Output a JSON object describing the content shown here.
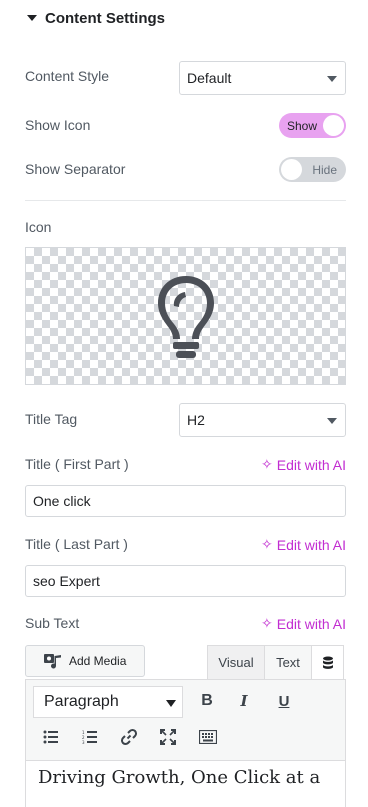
{
  "section": {
    "title": "Content Settings"
  },
  "content_style": {
    "label": "Content Style",
    "value": "Default"
  },
  "show_icon": {
    "label": "Show Icon",
    "state_text": "Show"
  },
  "show_separator": {
    "label": "Show Separator",
    "state_text": "Hide"
  },
  "icon": {
    "label": "Icon",
    "preview_icon": "lightbulb-icon"
  },
  "title_tag": {
    "label": "Title Tag",
    "value": "H2"
  },
  "title_first": {
    "label": "Title ( First Part )",
    "ai_label": "Edit with AI",
    "value": "One click"
  },
  "title_last": {
    "label": "Title ( Last Part )",
    "ai_label": "Edit with AI",
    "value": "seo Expert"
  },
  "sub_text": {
    "label": "Sub Text",
    "ai_label": "Edit with AI",
    "add_media_label": "Add Media",
    "tab_visual": "Visual",
    "tab_text": "Text",
    "format_value": "Paragraph",
    "bold": "B",
    "italic": "I",
    "underline": "U",
    "content": "Driving Growth, One Click at a"
  },
  "colors": {
    "accent": "#c22dd1",
    "toggle_on": "#e8a2f0",
    "toggle_off": "#d5d8dc"
  }
}
